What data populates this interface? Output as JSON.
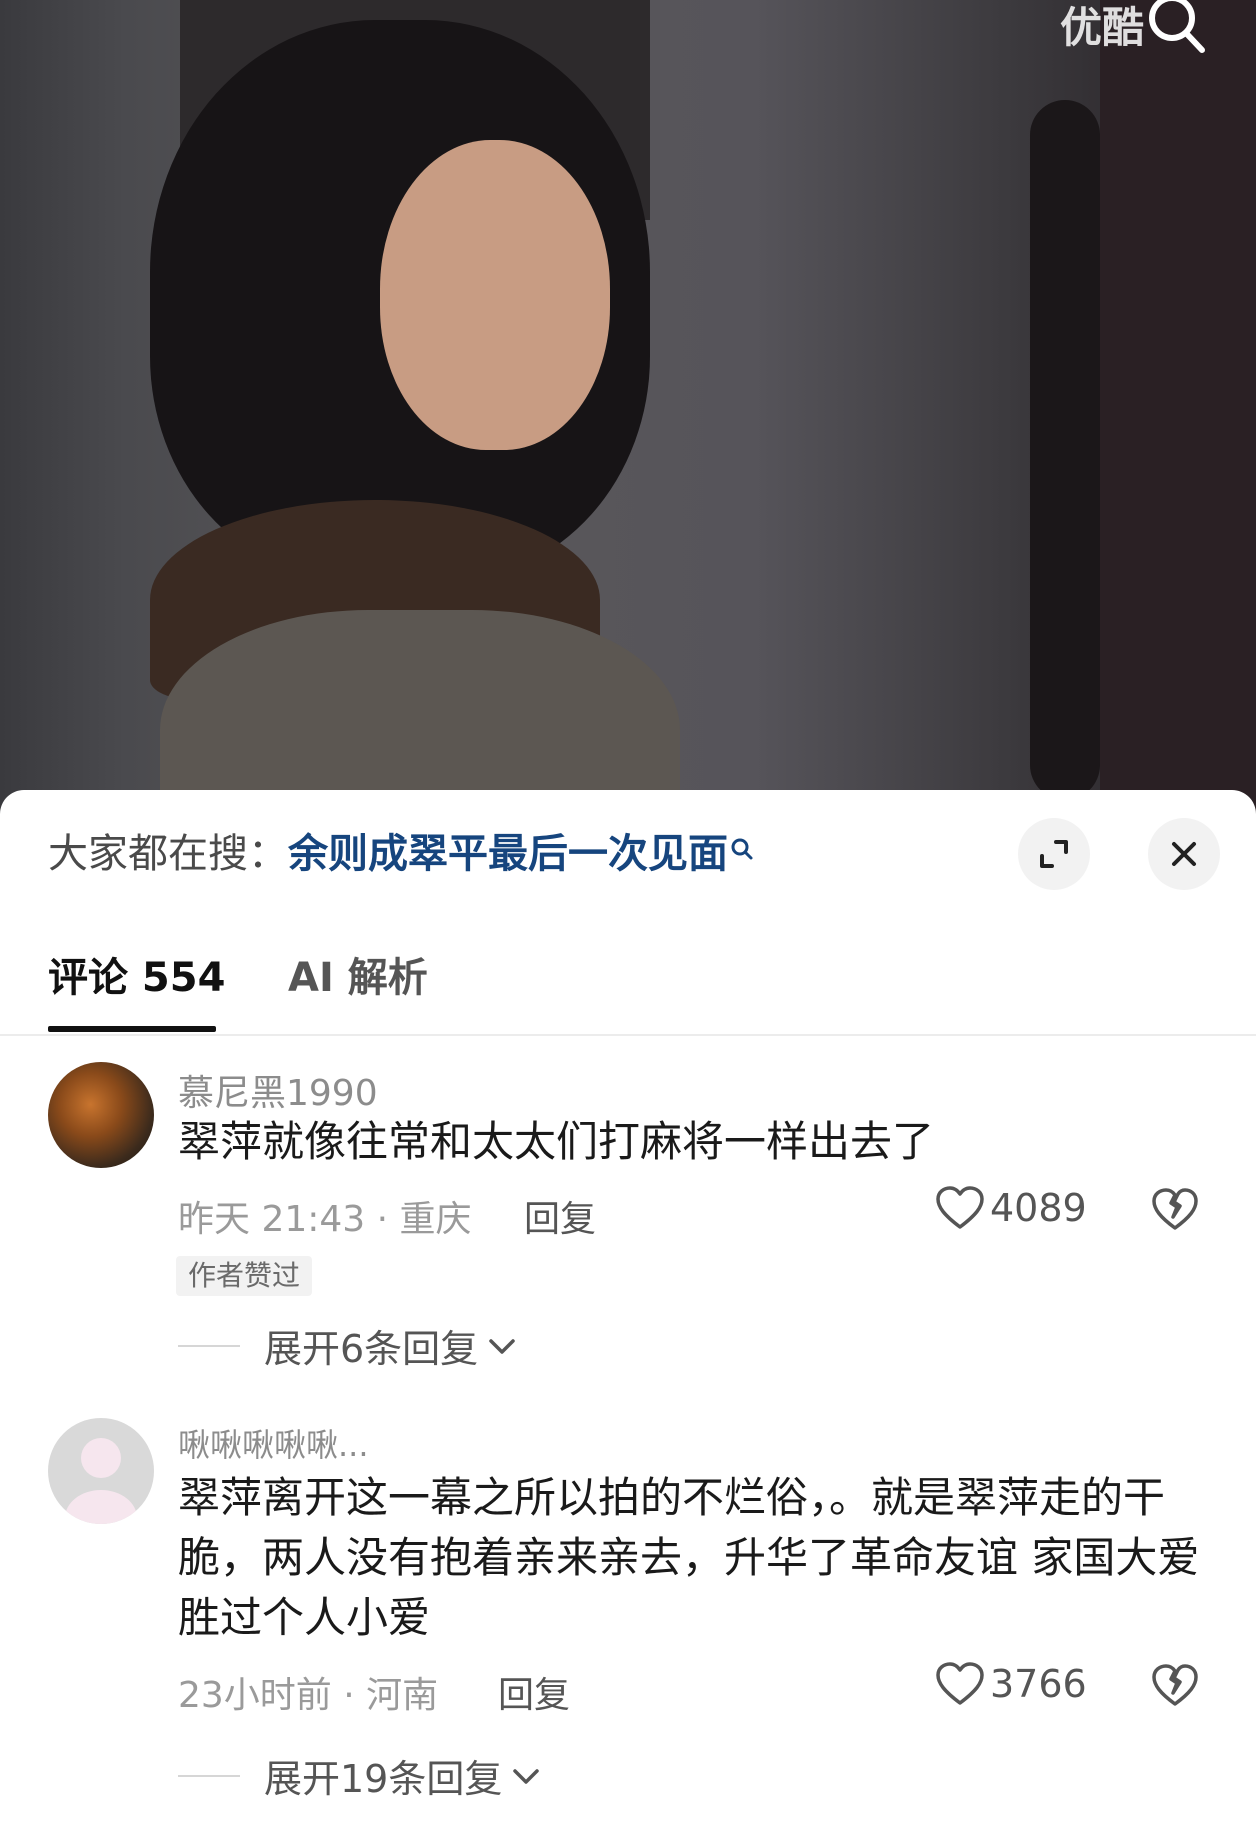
{
  "video": {
    "logo_text": "优酷"
  },
  "trending": {
    "label": "大家都在搜：",
    "query": "余则成翠平最后一次见面"
  },
  "tabs": [
    {
      "label": "评论 554"
    },
    {
      "label": "AI 解析"
    }
  ],
  "comments": [
    {
      "username": "慕尼黑1990",
      "text": "翠萍就像往常和太太们打麻将一样出去了",
      "time_location": "昨天 21:43 · 重庆",
      "reply_label": "回复",
      "likes": "4089",
      "badge": "作者赞过",
      "expand_label": "展开6条回复"
    },
    {
      "username": "啾啾啾啾啾...",
      "text": "翠萍离开这一幕之所以拍的不烂俗，。就是翠萍走的干脆，两人没有抱着亲来亲去，升华了革命友谊 家国大爱胜过个人小爱",
      "time_location": "23小时前 · 河南",
      "reply_label": "回复",
      "likes": "3766",
      "expand_label": "展开19条回复"
    }
  ],
  "colors": {
    "query_link": "#16457e",
    "tab_active": "#111111",
    "meta_grey": "#9a9a9a"
  },
  "icons": [
    "search-icon",
    "expand-icon",
    "close-icon",
    "heart-icon",
    "broken-heart-icon",
    "chevron-down-icon"
  ]
}
